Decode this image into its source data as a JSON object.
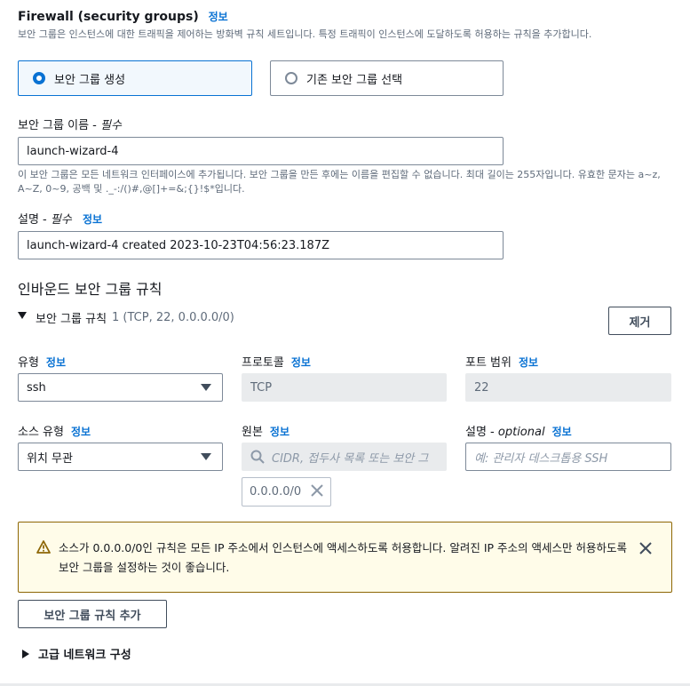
{
  "firewall": {
    "title": "Firewall (security groups)",
    "info": "정보",
    "description": "보안 그룹은 인스턴스에 대한 트래픽을 제어하는 방화벽 규칙 세트입니다. 특정 트래픽이 인스턴스에 도달하도록 허용하는 규칙을 추가합니다.",
    "options": [
      {
        "label": "보안 그룹 생성",
        "selected": true
      },
      {
        "label": "기존 보안 그룹 선택",
        "selected": false
      }
    ]
  },
  "group_name": {
    "label": "보안 그룹 이름 - ",
    "required": "필수",
    "value": "launch-wizard-4",
    "hint": "이 보안 그룹은 모든 네트워크 인터페이스에 추가됩니다. 보안 그룹을 만든 후에는 이름을 편집할 수 없습니다. 최대 길이는 255자입니다. 유효한 문자는 a~z, A~Z, 0~9, 공백 및 ._-:/()#,@[]+=&;{}!$*입니다."
  },
  "group_desc": {
    "label": "설명 - ",
    "required": "필수",
    "info": "정보",
    "value": "launch-wizard-4 created 2023-10-23T04:56:23.187Z"
  },
  "inbound": {
    "title": "인바운드 보안 그룹 규칙",
    "rule_title": "보안 그룹 규칙",
    "rule_summary": "1 (TCP, 22, 0.0.0.0/0)",
    "remove_label": "제거",
    "type_label": "유형",
    "protocol_label": "프로토콜",
    "port_label": "포트 범위",
    "info": "정보",
    "type_value": "ssh",
    "protocol_value": "TCP",
    "port_value": "22",
    "source_type_label": "소스 유형",
    "source_label": "원본",
    "desc_label": "설명 - ",
    "desc_optional": "optional",
    "source_type_value": "위치 무관",
    "source_placeholder": "CIDR, 접두사 목록 또는 보안 그",
    "desc_placeholder": "예: 관리자 데스크톱용 SSH",
    "source_token": "0.0.0.0/0"
  },
  "warning": {
    "text": "소스가 0.0.0.0/0인 규칙은 모든 IP 주소에서 인스턴스에 액세스하도록 허용합니다. 알려진 IP 주소의 액세스만 허용하도록 보안 그룹을 설정하는 것이 좋습니다."
  },
  "add_rule_label": "보안 그룹 규칙 추가",
  "advanced_label": "고급 네트워크 구성",
  "colors": {
    "accent": "#0972d3",
    "warning_border": "#8d6605",
    "warning_bg": "#fffce9"
  }
}
